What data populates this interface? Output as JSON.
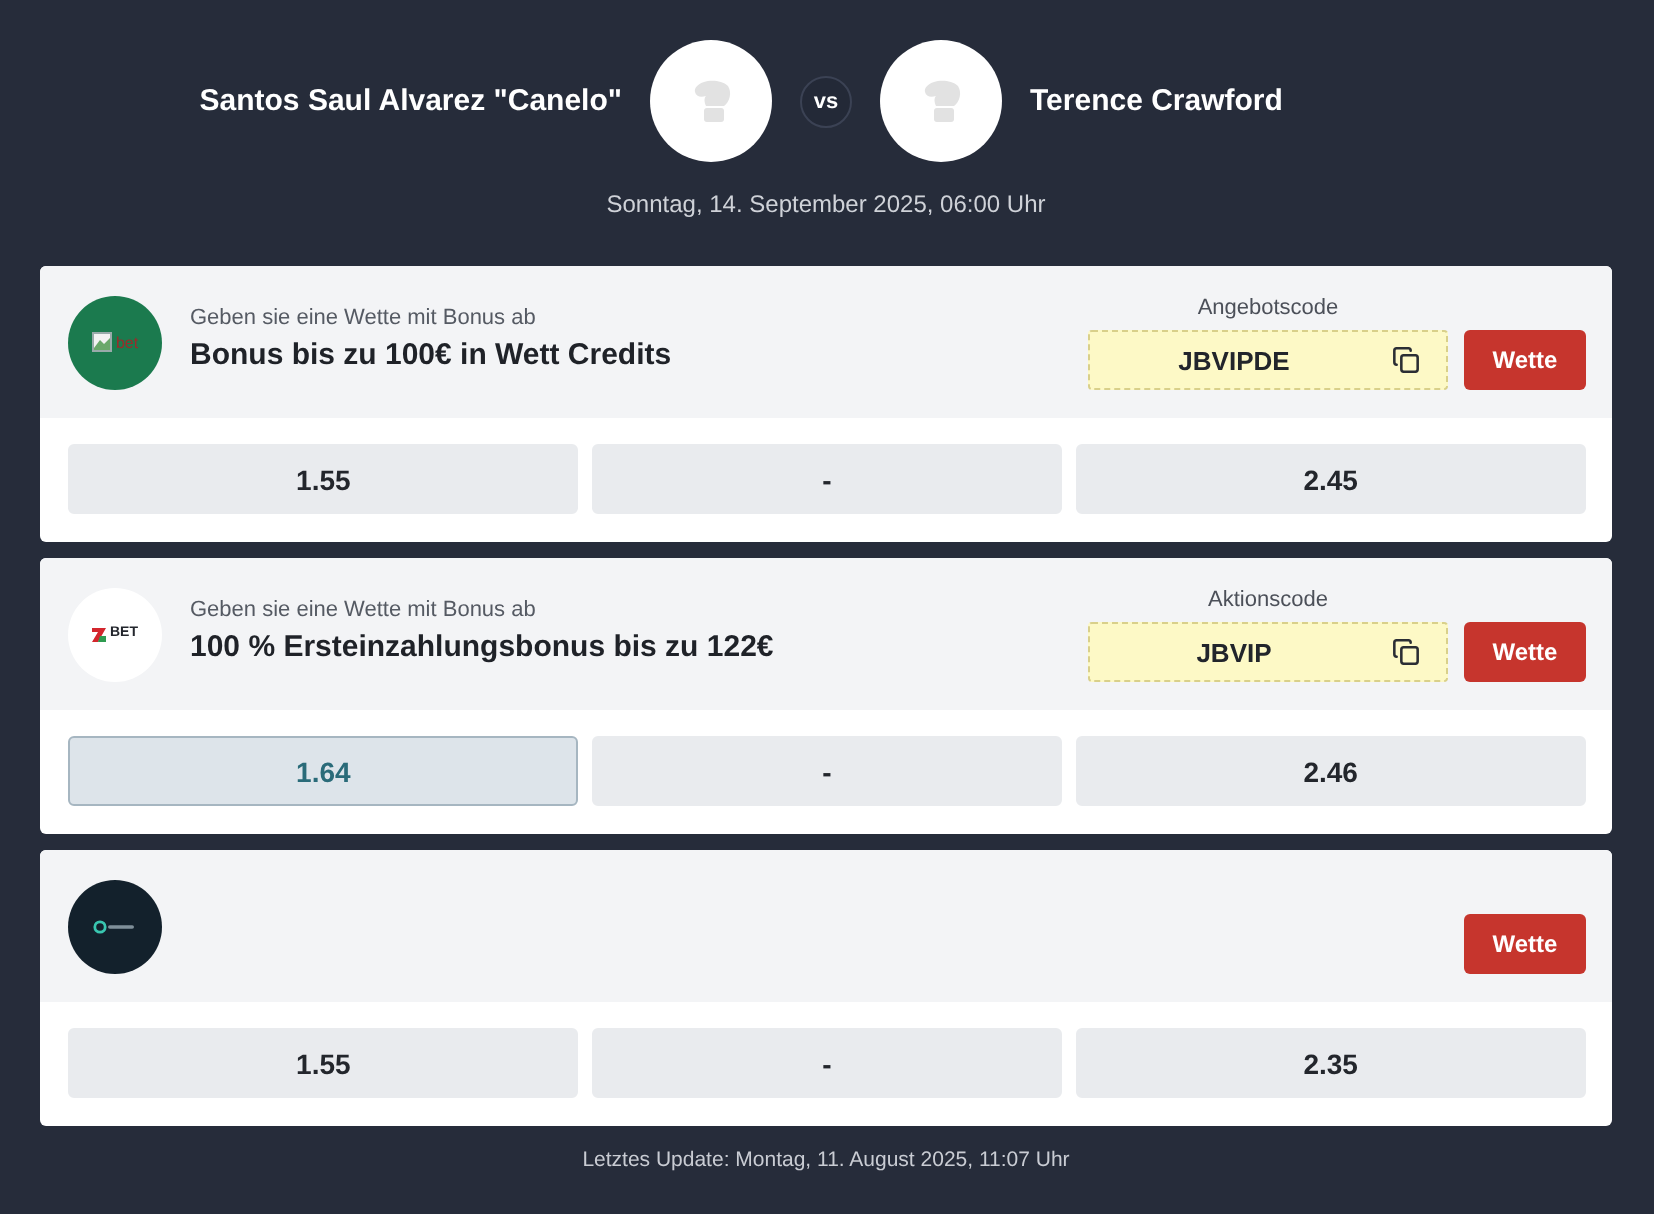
{
  "match": {
    "fighter_1": "Santos Saul Alvarez \"Canelo\"",
    "vs": "vs",
    "fighter_2": "Terence Crawford",
    "date": "Sonntag, 14. September 2025, 06:00 Uhr"
  },
  "offers": [
    {
      "logo": {
        "kind": "broken-image",
        "text": "bet"
      },
      "subtitle": "Geben sie eine Wette mit Bonus ab",
      "title": "Bonus bis zu 100€ in Wett Credits",
      "code_label": "Angebotscode",
      "code": "JBVIPDE",
      "button": "Wette",
      "odds": [
        {
          "value": "1.55",
          "highlighted": false
        },
        {
          "value": "-",
          "highlighted": false
        },
        {
          "value": "2.45",
          "highlighted": false
        }
      ]
    },
    {
      "logo": {
        "kind": "wordmark",
        "text": "BET"
      },
      "subtitle": "Geben sie eine Wette mit Bonus ab",
      "title": "100 % Ersteinzahlungsbonus bis zu 122€",
      "code_label": "Aktionscode",
      "code": "JBVIP",
      "button": "Wette",
      "odds": [
        {
          "value": "1.64",
          "highlighted": true
        },
        {
          "value": "-",
          "highlighted": false
        },
        {
          "value": "2.46",
          "highlighted": false
        }
      ]
    },
    {
      "logo": {
        "kind": "mark"
      },
      "button": "Wette",
      "odds": [
        {
          "value": "1.55",
          "highlighted": false
        },
        {
          "value": "-",
          "highlighted": false
        },
        {
          "value": "2.35",
          "highlighted": false
        }
      ]
    }
  ],
  "footer": "Letztes Update: Montag, 11. August 2025, 11:07 Uhr"
}
